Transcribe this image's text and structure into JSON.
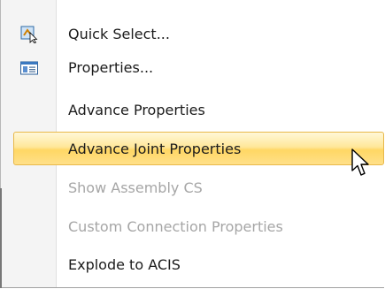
{
  "menu": {
    "items": [
      {
        "label": "Quick Select...",
        "icon": "quick-select-icon",
        "state": "normal"
      },
      {
        "label": "Properties...",
        "icon": "properties-icon",
        "state": "normal"
      },
      {
        "label": "Advance Properties",
        "icon": null,
        "state": "normal"
      },
      {
        "label": "Advance Joint Properties",
        "icon": null,
        "state": "hover"
      },
      {
        "label": "Show Assembly CS",
        "icon": null,
        "state": "disabled"
      },
      {
        "label": "Custom Connection Properties",
        "icon": null,
        "state": "disabled"
      },
      {
        "label": "Explode to ACIS",
        "icon": null,
        "state": "normal"
      }
    ]
  },
  "colors": {
    "hover_border": "#e8b84a",
    "hover_fill": "#ffd764",
    "disabled_text": "#a6a6a6",
    "text": "#1b1b1b"
  }
}
